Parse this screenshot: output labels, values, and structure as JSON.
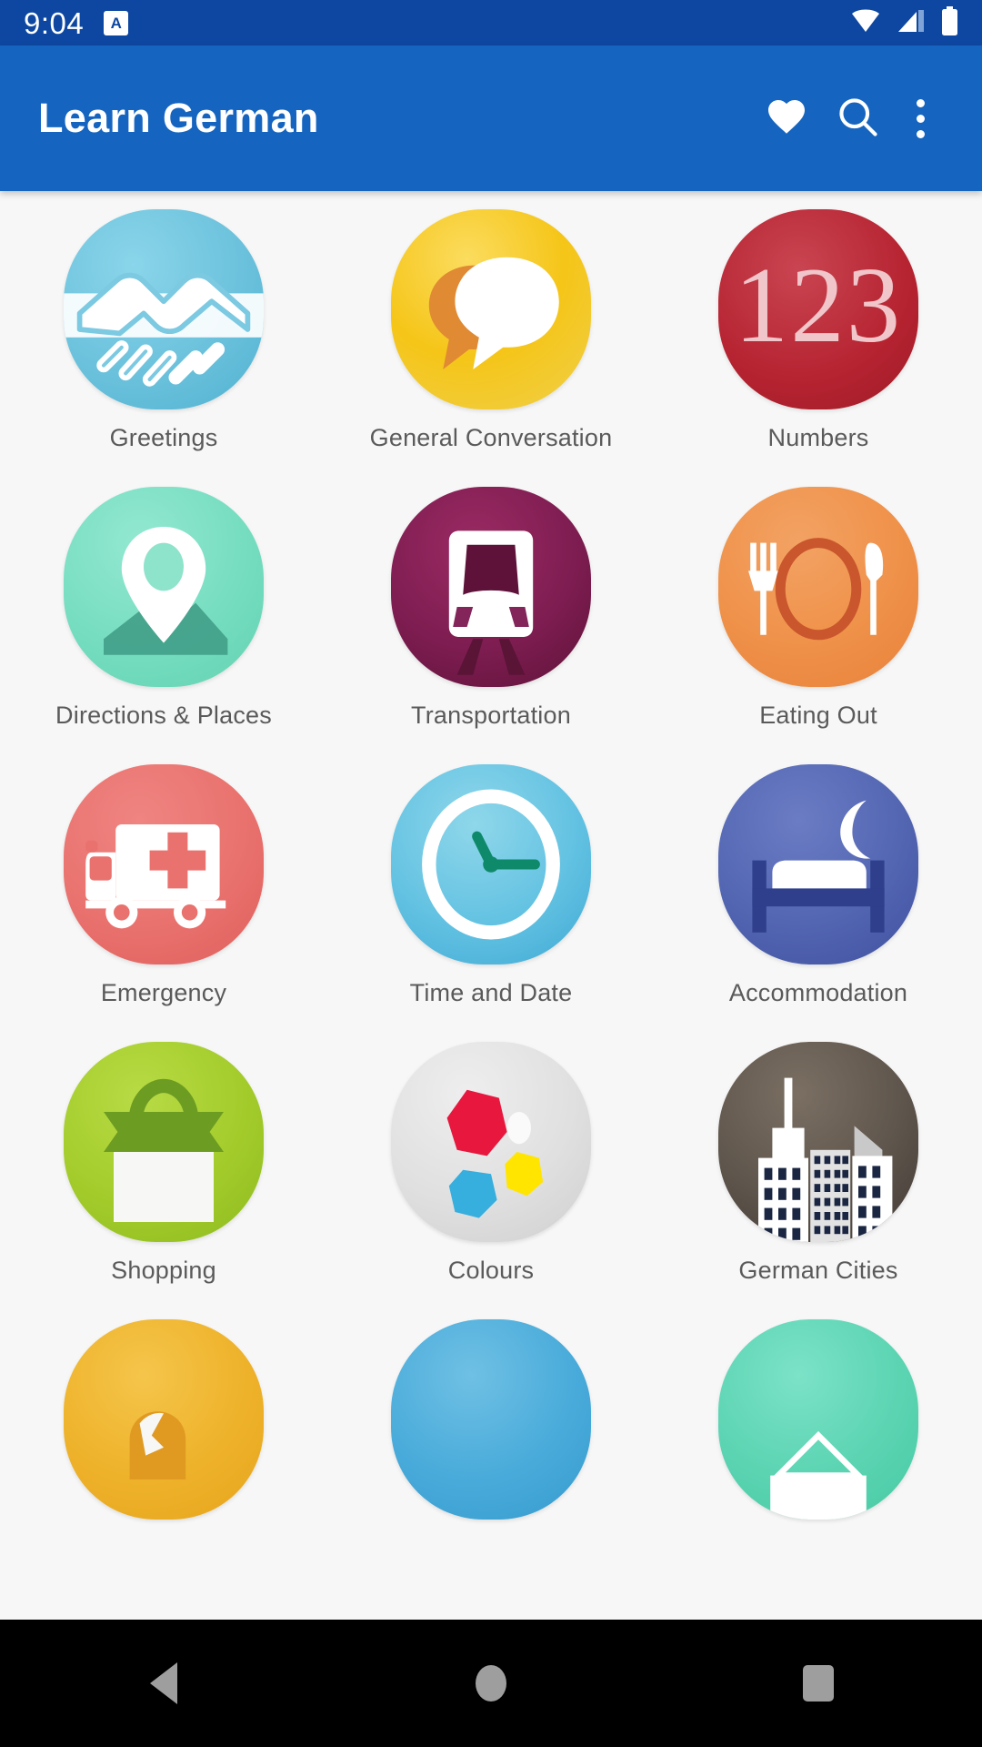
{
  "status_bar": {
    "time": "9:04",
    "app_badge_letter": "A",
    "icons": [
      "wifi-icon",
      "signal-icon",
      "battery-icon"
    ],
    "background": "#0d47a1"
  },
  "app_bar": {
    "title": "Learn German",
    "background": "#1565c0",
    "actions": [
      {
        "name": "favorites-button",
        "icon": "heart-icon"
      },
      {
        "name": "search-button",
        "icon": "search-icon"
      },
      {
        "name": "overflow-menu-button",
        "icon": "more-vertical-icon"
      }
    ]
  },
  "grid": {
    "columns": 3,
    "categories": [
      {
        "label": "Greetings",
        "icon": "handshake-icon",
        "color_start": "#7ecfe6",
        "color_end": "#5bb8d6"
      },
      {
        "label": "General Conversation",
        "icon": "speech-bubbles-icon",
        "color_start": "#f5c518",
        "color_end": "#f0d94f"
      },
      {
        "label": "Numbers",
        "icon": "123-icon",
        "color_start": "#b62331",
        "color_end": "#c4404c"
      },
      {
        "label": "Directions & Places",
        "icon": "map-pin-icon",
        "color_start": "#7fe0c5",
        "color_end": "#6fd9bd"
      },
      {
        "label": "Transportation",
        "icon": "train-icon",
        "color_start": "#8e2159",
        "color_end": "#6d1a44"
      },
      {
        "label": "Eating Out",
        "icon": "cutlery-plate-icon",
        "color_start": "#f0934a",
        "color_end": "#e8853c"
      },
      {
        "label": "Emergency",
        "icon": "ambulance-icon",
        "color_start": "#e9726e",
        "color_end": "#e06663"
      },
      {
        "label": "Time and Date",
        "icon": "clock-icon",
        "color_start": "#79cde5",
        "color_end": "#48b6dd"
      },
      {
        "label": "Accommodation",
        "icon": "bed-moon-icon",
        "color_start": "#5a6bb5",
        "color_end": "#4356a3"
      },
      {
        "label": "Shopping",
        "icon": "shopping-bag-icon",
        "color_start": "#a8cf2e",
        "color_end": "#96c228"
      },
      {
        "label": "Colours",
        "icon": "colour-shapes-icon",
        "color_start": "#e3e3e3",
        "color_end": "#d2d2d2"
      },
      {
        "label": "German Cities",
        "icon": "city-skyline-icon",
        "color_start": "#6d6258",
        "color_end": "#4a423b"
      },
      {
        "label": "",
        "icon": "partial-amber-icon",
        "color_start": "#f0b62e",
        "color_end": "#e8a81f"
      },
      {
        "label": "",
        "icon": "partial-blue-icon",
        "color_start": "#4fb0dd",
        "color_end": "#3aa0d3"
      },
      {
        "label": "",
        "icon": "partial-teal-icon",
        "color_start": "#62d9bd",
        "color_end": "#4ecfae"
      }
    ]
  },
  "nav_bar": {
    "background": "#000000",
    "buttons": [
      {
        "name": "nav-back-button",
        "icon": "back-triangle-icon"
      },
      {
        "name": "nav-home-button",
        "icon": "home-circle-icon"
      },
      {
        "name": "nav-recents-button",
        "icon": "recents-square-icon"
      }
    ]
  }
}
